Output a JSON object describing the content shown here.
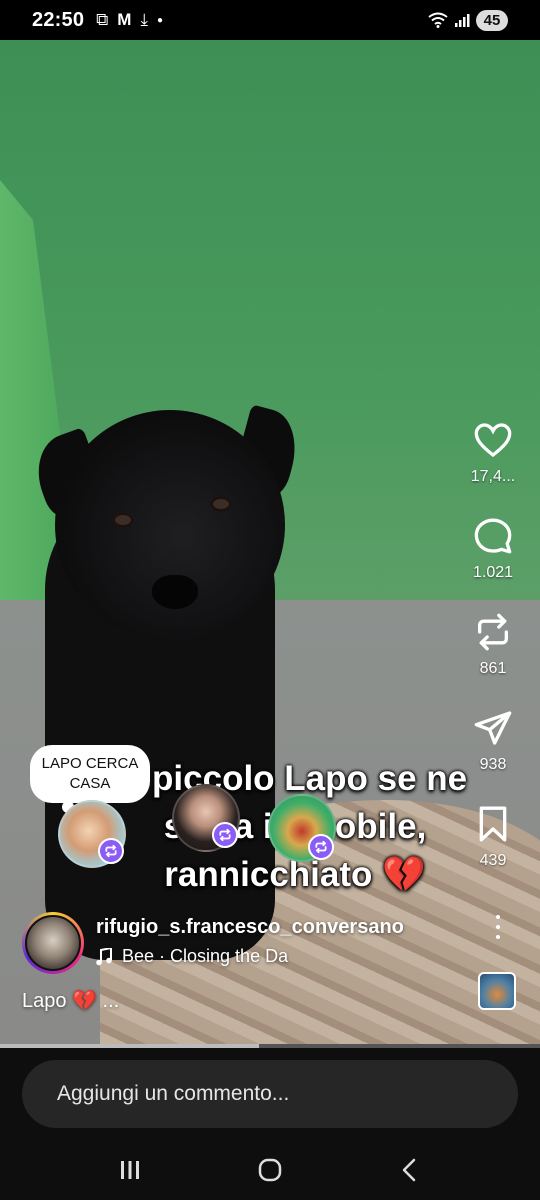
{
  "status_bar": {
    "time": "22:50",
    "left_icons": [
      "screenshot-icon",
      "gmail-icon",
      "download-icon",
      "dot-icon"
    ],
    "right_icons": [
      "wifi-icon",
      "signal-icon"
    ],
    "battery": "45"
  },
  "actions": {
    "like_count": "17,4...",
    "comment_count": "1.021",
    "repost_count": "861",
    "share_count": "938",
    "save_count": "439"
  },
  "overlay": {
    "caption_line1": "Il piccolo Lapo se ne",
    "caption_line2": "stava immobile,",
    "caption_line3": "rannicchiato 💔",
    "note_text": "LAPO CERCA CASA"
  },
  "author": {
    "username": "rifugio_s.francesco_conversano",
    "music": "Bee · Closing the Da"
  },
  "post": {
    "caption": "Lapo 💔 ..."
  },
  "progress": {
    "fraction": 0.48
  },
  "comment": {
    "placeholder": "Aggiungi un commento..."
  },
  "colors": {
    "repost_badge": "#8b5cf6",
    "accent_green": "#4ea85c"
  }
}
